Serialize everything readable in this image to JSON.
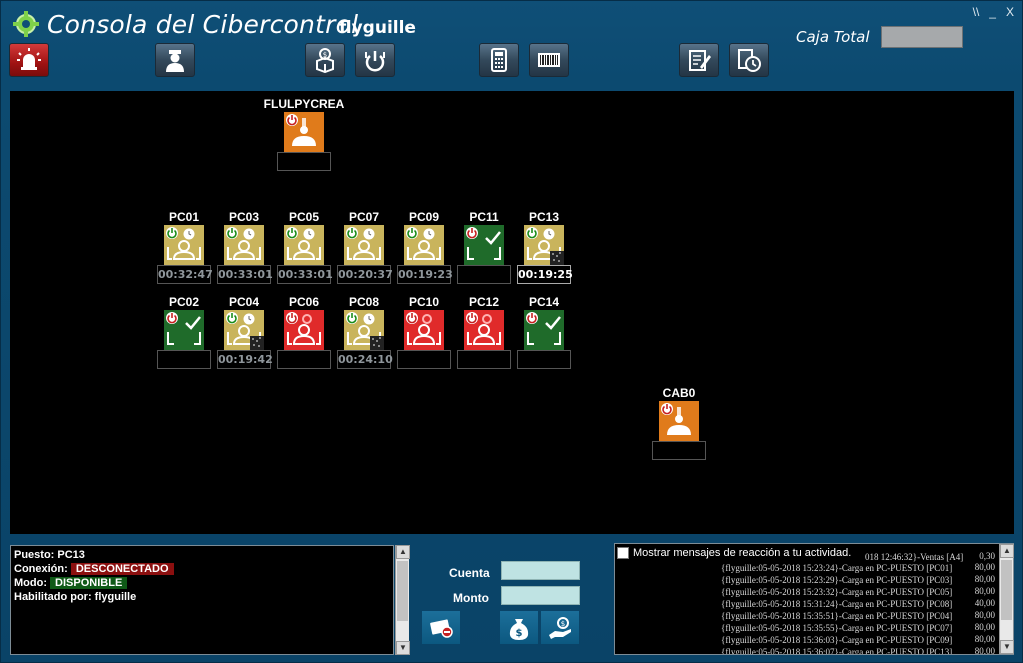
{
  "header": {
    "title": "Consola del Cibercontrol",
    "user": "flyguille",
    "caja_label": "Caja Total",
    "caja_value": "",
    "window_controls": [
      "\\\\",
      "_",
      "X"
    ]
  },
  "toolbar": [
    {
      "name": "alarm-button",
      "icon": "siren-icon"
    },
    {
      "name": "operator-button",
      "icon": "operator-icon"
    },
    {
      "name": "sell-products-button",
      "icon": "money-box-icon"
    },
    {
      "name": "power-all-button",
      "icon": "power-icon"
    },
    {
      "name": "calculator-button",
      "icon": "calculator-icon"
    },
    {
      "name": "barcode-button",
      "icon": "barcode-icon"
    },
    {
      "name": "notes-button",
      "icon": "edit-note-icon"
    },
    {
      "name": "history-button",
      "icon": "clock-report-icon"
    }
  ],
  "stations": [
    {
      "id": "flulpycrea",
      "name": "FLULPYCREA",
      "status": "orange-disconnected",
      "timer": ""
    },
    {
      "id": "pc01",
      "name": "PC01",
      "status": "yellow-active",
      "timer": "00:32:47"
    },
    {
      "id": "pc03",
      "name": "PC03",
      "status": "yellow-active",
      "timer": "00:33:01"
    },
    {
      "id": "pc05",
      "name": "PC05",
      "status": "yellow-active",
      "timer": "00:33:01"
    },
    {
      "id": "pc07",
      "name": "PC07",
      "status": "yellow-active",
      "timer": "00:20:37"
    },
    {
      "id": "pc09",
      "name": "PC09",
      "status": "yellow-active",
      "timer": "00:19:23"
    },
    {
      "id": "pc11",
      "name": "PC11",
      "status": "green-free",
      "timer": ""
    },
    {
      "id": "pc13",
      "name": "PC13",
      "status": "yellow-selected",
      "timer": "00:19:25"
    },
    {
      "id": "pc02",
      "name": "PC02",
      "status": "green-free",
      "timer": ""
    },
    {
      "id": "pc04",
      "name": "PC04",
      "status": "yellow-selected",
      "timer": "00:19:42"
    },
    {
      "id": "pc06",
      "name": "PC06",
      "status": "red-maintenance",
      "timer": ""
    },
    {
      "id": "pc08",
      "name": "PC08",
      "status": "yellow-selected",
      "timer": "00:24:10"
    },
    {
      "id": "pc10",
      "name": "PC10",
      "status": "red-maintenance",
      "timer": ""
    },
    {
      "id": "pc12",
      "name": "PC12",
      "status": "red-maintenance",
      "timer": ""
    },
    {
      "id": "pc14",
      "name": "PC14",
      "status": "green-free",
      "timer": ""
    },
    {
      "id": "cab0",
      "name": "CAB0",
      "status": "orange-disconnected",
      "timer": ""
    }
  ],
  "info": {
    "puesto_label": "Puesto:",
    "puesto": "PC13",
    "conexion_label": "Conexión:",
    "conexion": "DESCONECTADO",
    "modo_label": "Modo:",
    "modo": "DISPONIBLE",
    "habilitado_label": "Habilitado por:",
    "habilitado": "flyguille"
  },
  "payment": {
    "cuenta_label": "Cuenta",
    "monto_label": "Monto",
    "cuenta_value": "",
    "monto_value": ""
  },
  "bottom_buttons": [
    {
      "name": "cancel-payment-button",
      "icon": "card-cancel-icon"
    },
    {
      "name": "charge-button",
      "icon": "money-bag-icon"
    },
    {
      "name": "pay-button",
      "icon": "hand-money-icon"
    }
  ],
  "log": {
    "checkbox_label": "Mostrar mensajes de reacción a tu actividad.",
    "lines": [
      {
        "text": "018 12:46:32}-Ventas [A4]",
        "value": "0,30"
      },
      {
        "text": "{flyguille:05-05-2018 15:23:24}-Carga en PC-PUESTO [PC01]",
        "value": "80,00"
      },
      {
        "text": "{flyguille:05-05-2018 15:23:29}-Carga en PC-PUESTO [PC03]",
        "value": "80,00"
      },
      {
        "text": "{flyguille:05-05-2018 15:23:32}-Carga en PC-PUESTO [PC05]",
        "value": "80,00"
      },
      {
        "text": "{flyguille:05-05-2018 15:31:24}-Carga en PC-PUESTO [PC08]",
        "value": "40,00"
      },
      {
        "text": "{flyguille:05-05-2018 15:35:51}-Carga en PC-PUESTO [PC04]",
        "value": "80,00"
      },
      {
        "text": "{flyguille:05-05-2018 15:35:55}-Carga en PC-PUESTO [PC07]",
        "value": "80,00"
      },
      {
        "text": "{flyguille:05-05-2018 15:36:03}-Carga en PC-PUESTO [PC09]",
        "value": "80,00"
      },
      {
        "text": "{flyguille:05-05-2018 15:36:07}-Carga en PC-PUESTO [PC13]",
        "value": "80,00"
      }
    ]
  },
  "colors": {
    "background": "#0e4f76",
    "map": "#000000",
    "yellow_tile": "#c9b45c",
    "green_tile": "#1f6b2a",
    "red_tile": "#e02a2a",
    "orange_tile": "#e07b1b",
    "desconectado_badge": "#8b0f0f",
    "disponible_badge": "#0f5a17"
  }
}
